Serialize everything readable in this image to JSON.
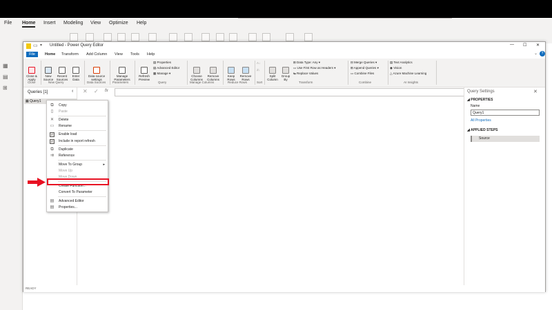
{
  "outer": {
    "menu": [
      "File",
      "Home",
      "Insert",
      "Modeling",
      "View",
      "Optimize",
      "Help"
    ],
    "active_menu": "Home"
  },
  "window": {
    "title": "Untitled - Power Query Editor",
    "controls": [
      "—",
      "☐",
      "✕"
    ]
  },
  "tabs": [
    "File",
    "Home",
    "Transform",
    "Add Column",
    "View",
    "Tools",
    "Help"
  ],
  "ribbon": {
    "close_apply": "Close &\nApply",
    "new_source": "New\nSource",
    "recent_sources": "Recent\nSources",
    "enter_data": "Enter\nData",
    "data_source_settings": "Data source\nsettings",
    "manage_parameters": "Manage\nParameters",
    "refresh_preview": "Refresh\nPreview",
    "properties": "Properties",
    "advanced_editor": "Advanced Editor",
    "manage": "Manage",
    "choose_columns": "Choose\nColumns",
    "remove_columns": "Remove\nColumns",
    "keep_rows": "Keep\nRows",
    "remove_rows": "Remove\nRows",
    "split_column": "Split\nColumn",
    "group_by": "Group\nBy",
    "data_type": "Data Type: Any",
    "use_first_row": "Use First Row as Headers",
    "replace_values": "Replace Values",
    "merge_queries": "Merge Queries",
    "append_queries": "Append Queries",
    "combine_files": "Combine Files",
    "text_analytics": "Text Analytics",
    "vision": "Vision",
    "azure_ml": "Azure Machine Learning",
    "groups": [
      "Close",
      "New Query",
      "Data Sources",
      "Parameters",
      "Query",
      "Manage Columns",
      "Reduce Rows",
      "Sort",
      "Transform",
      "Combine",
      "AI Insights"
    ]
  },
  "queries": {
    "header": "Queries [1]",
    "items": [
      "Query1"
    ]
  },
  "formula": {
    "fx": "fx"
  },
  "settings": {
    "title": "Query Settings",
    "properties_header": "PROPERTIES",
    "name_label": "Name",
    "name_value": "Query1",
    "all_properties": "All Properties",
    "applied_steps_header": "APPLIED STEPS",
    "steps": [
      "Source"
    ]
  },
  "status": "READY",
  "context_menu": {
    "items": [
      {
        "label": "Copy",
        "icon": "copy-icon"
      },
      {
        "label": "Paste",
        "icon": "paste-icon",
        "disabled": true
      },
      {
        "label": "Delete",
        "icon": "delete-icon"
      },
      {
        "label": "Rename",
        "icon": "rename-icon"
      },
      {
        "label": "Enable load",
        "icon": "check-icon"
      },
      {
        "label": "Include in report refresh",
        "icon": "check-icon"
      },
      {
        "label": "Duplicate",
        "icon": "duplicate-icon"
      },
      {
        "label": "Reference",
        "icon": "reference-icon"
      },
      {
        "label": "Move To Group",
        "icon": ""
      },
      {
        "label": "Move Up",
        "icon": "",
        "disabled": true
      },
      {
        "label": "Move Down",
        "icon": "",
        "disabled": true
      },
      {
        "label": "Create Function...",
        "icon": ""
      },
      {
        "label": "Convert To Parameter",
        "icon": ""
      },
      {
        "label": "Advanced Editor",
        "icon": "advanced-editor-icon",
        "highlighted": true
      },
      {
        "label": "Properties...",
        "icon": "properties-icon"
      }
    ]
  },
  "colors": {
    "highlight_border": "#e81123",
    "arrow": "#e81123",
    "file_tab": "#0f6cbd"
  }
}
